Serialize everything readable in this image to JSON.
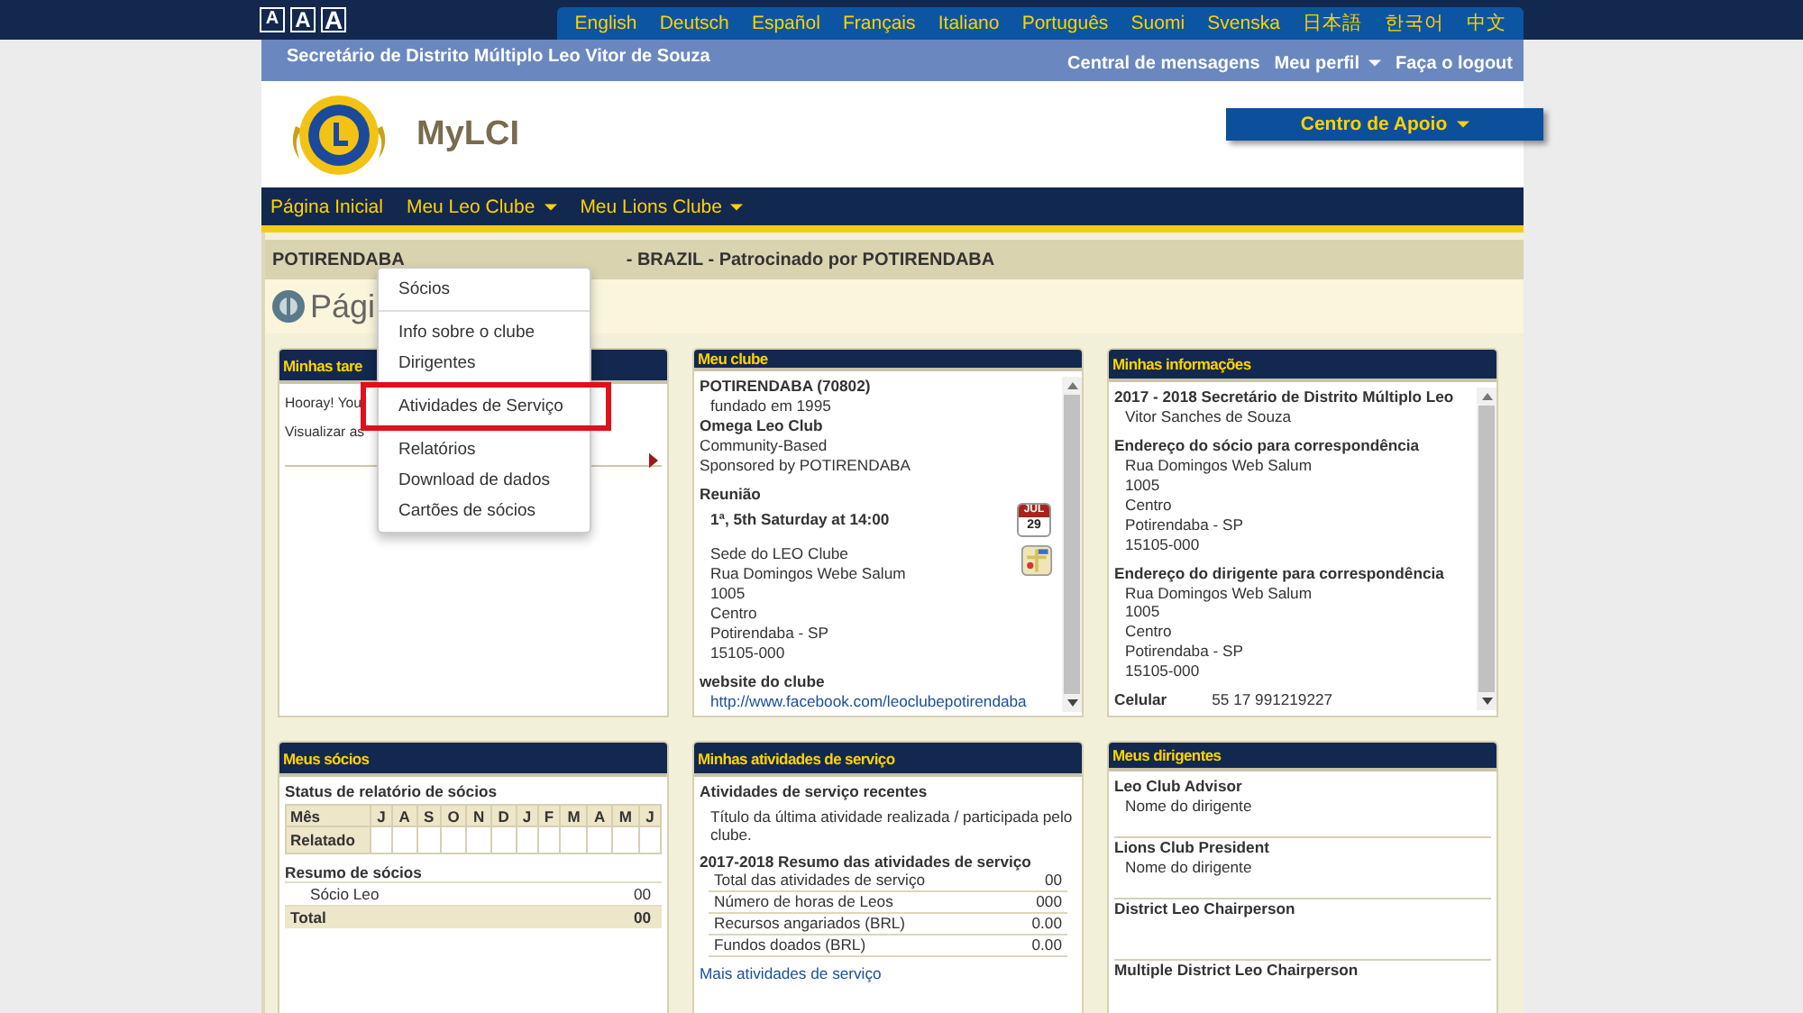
{
  "text_sizes": [
    "A",
    "A",
    "A"
  ],
  "languages": [
    "English",
    "Deutsch",
    "Español",
    "Français",
    "Italiano",
    "Português",
    "Suomi",
    "Svenska",
    "日本語",
    "한국어",
    "中文"
  ],
  "user_bar": {
    "title": "Secretário de Distrito Múltiplo Leo Vitor de Souza",
    "links": [
      {
        "label": "Central de mensagens",
        "dropdown": false
      },
      {
        "label": "Meu perfil",
        "dropdown": true
      },
      {
        "label": "Faça o logout",
        "dropdown": false
      }
    ]
  },
  "header": {
    "app_name": "MyLCI",
    "support_button": "Centro de Apoio"
  },
  "nav": [
    {
      "label": "Página Inicial",
      "dropdown": false
    },
    {
      "label": "Meu Leo Clube",
      "dropdown": true
    },
    {
      "label": "Meu Lions Clube",
      "dropdown": true
    }
  ],
  "dropdown_menu": {
    "sections": [
      [
        {
          "label": "Sócios",
          "highlighted": false
        }
      ],
      [
        {
          "label": "Info sobre o clube",
          "highlighted": false
        },
        {
          "label": "Dirigentes",
          "highlighted": false
        }
      ],
      [
        {
          "label": "Atividades de Serviço",
          "highlighted": true
        }
      ],
      [
        {
          "label": "Relatórios",
          "highlighted": false
        },
        {
          "label": "Download de dados",
          "highlighted": false
        },
        {
          "label": "Cartões de sócios",
          "highlighted": false
        }
      ]
    ]
  },
  "club_bar": {
    "left": "POTIRENDABA",
    "right": "- BRAZIL - Patrocinado por POTIRENDABA"
  },
  "page_title": "Pági",
  "my_tasks": {
    "title": "Minhas tare",
    "lines": [
      "Hooray! You",
      "Visualizar as"
    ]
  },
  "my_club": {
    "title": "Meu clube",
    "name": "POTIRENDABA (70802)",
    "founded": "fundado em 1995",
    "type": "Omega Leo Club",
    "lines": [
      "Community-Based",
      "Sponsored by POTIRENDABA"
    ],
    "meeting_label": "Reunião",
    "meeting_time": "1ª, 5th Saturday at 14:00",
    "calendar_month": "JUL",
    "calendar_day": "29",
    "address": [
      "Sede do LEO Clube",
      "Rua Domingos Webe Salum",
      "1005",
      "Centro",
      "Potirendaba - SP",
      "15105-000"
    ],
    "website_label": "website do clube",
    "website": "http://www.facebook.com/leoclubepotirendaba"
  },
  "my_info": {
    "title": "Minhas informações",
    "role": "2017 - 2018 Secretário de Distrito Múltiplo Leo",
    "person": "Vitor Sanches de Souza",
    "addresses": [
      {
        "label": "Endereço do sócio para correspondência",
        "lines": [
          "Rua Domingos Web Salum",
          "1005",
          "Centro",
          "Potirendaba - SP",
          "15105-000"
        ]
      },
      {
        "label": "Endereço do dirigente para correspondência",
        "lines": [
          "Rua Domingos Web Salum",
          "1005",
          "Centro",
          "Potirendaba - SP",
          "15105-000"
        ]
      }
    ],
    "phone_label": "Celular",
    "phone": "55 17 991219227"
  },
  "my_members": {
    "title": "Meus sócios",
    "status_label": "Status de relatório de sócios",
    "month_header": "Mês",
    "months": [
      "J",
      "A",
      "S",
      "O",
      "N",
      "D",
      "J",
      "F",
      "M",
      "A",
      "M",
      "J"
    ],
    "reported_label": "Relatado",
    "summary_label": "Resumo de sócios",
    "rows": [
      {
        "label": "Sócio Leo",
        "value": "00"
      }
    ],
    "total_label": "Total",
    "total": "00"
  },
  "my_activities": {
    "title": "Minhas atividades de serviço",
    "recent_label": "Atividades de serviço recentes",
    "recent_text": "Título da última atividade realizada / participada pelo clube.",
    "summary_label": "2017-2018 Resumo das atividades de serviço",
    "rows": [
      {
        "label": "Total das atividades de serviço",
        "value": "00"
      },
      {
        "label": "Número de horas de Leos",
        "value": "000"
      },
      {
        "label": "Recursos angariados (BRL)",
        "value": "0.00"
      },
      {
        "label": "Fundos doados (BRL)",
        "value": "0.00"
      }
    ],
    "more_link": "Mais atividades de serviço"
  },
  "my_officers": {
    "title": "Meus dirigentes",
    "officers": [
      {
        "role": "Leo Club Advisor",
        "name": "Nome do dirigente"
      },
      {
        "role": "Lions Club President",
        "name": "Nome do dirigente"
      },
      {
        "role": "District Leo Chairperson"
      },
      {
        "role": "Multiple District Leo Chairperson"
      }
    ]
  }
}
